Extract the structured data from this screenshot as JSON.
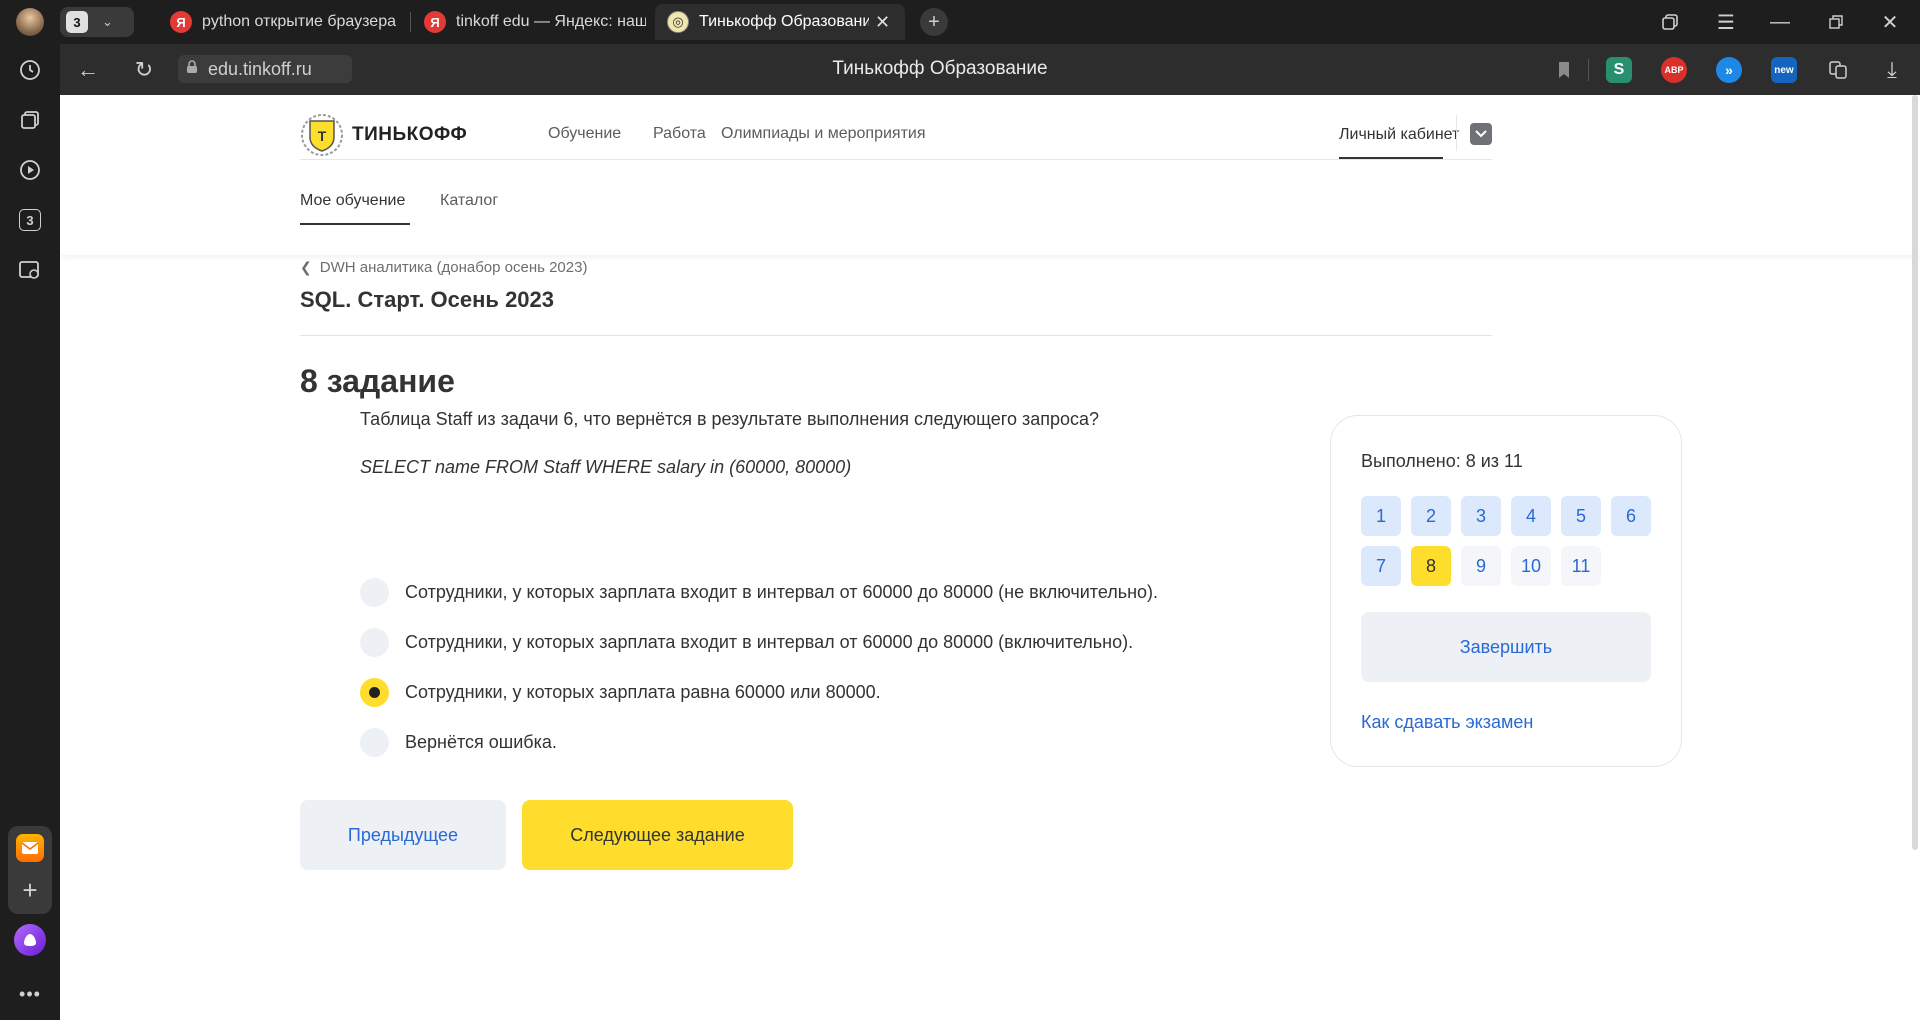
{
  "browser": {
    "tab_count": "3",
    "tabs": [
      {
        "label": "python открытие браузера",
        "favicon": "yandex-icon",
        "active": false
      },
      {
        "label": "tinkoff edu — Яндекс: наш",
        "favicon": "yandex-icon",
        "active": false
      },
      {
        "label": "Тинькофф Образование",
        "favicon": "tinkoff-icon",
        "active": true
      }
    ],
    "url": "edu.tinkoff.ru",
    "page_title": "Тинькофф Образование",
    "extensions": [
      {
        "name": "s-extension-icon",
        "label": "S",
        "color": "#2a8f6e"
      },
      {
        "name": "adblock-icon",
        "label": "ABP",
        "color": "#d9302c"
      },
      {
        "name": "blue-extension-icon",
        "label": "»",
        "color": "#1e88e5"
      },
      {
        "name": "new-extension-icon",
        "label": "new",
        "color": "#1565c0"
      }
    ],
    "sidebar_badge": "3"
  },
  "site": {
    "logo_text": "ТИНЬКОФФ",
    "nav": [
      "Обучение",
      "Работа",
      "Олимпиады и мероприятия"
    ],
    "account": "Личный кабинет",
    "subnav": [
      "Мое обучение",
      "Каталог"
    ]
  },
  "course": {
    "breadcrumb": "DWH аналитика (донабор осень 2023)",
    "title": "SQL. Старт. Осень 2023"
  },
  "task": {
    "heading": "8 задание",
    "question": "Таблица Staff из задачи 6, что вернётся в результате выполнения следующего запроса?",
    "code": "SELECT name FROM Staff WHERE salary in (60000, 80000)",
    "answers": [
      {
        "text": "Сотрудники, у которых зарплата входит в интервал от 60000 до 80000 (не включительно).",
        "selected": false
      },
      {
        "text": "Сотрудники, у которых зарплата входит в интервал от 60000 до 80000 (включительно).",
        "selected": false
      },
      {
        "text": "Сотрудники, у которых зарплата равна 60000 или 80000.",
        "selected": true
      },
      {
        "text": "Вернётся ошибка.",
        "selected": false
      }
    ],
    "prev_label": "Предыдущее",
    "next_label": "Следующее задание"
  },
  "progress": {
    "label": "Выполнено: 8 из 11",
    "completed": 8,
    "total": 11,
    "current": 8,
    "questions": [
      "1",
      "2",
      "3",
      "4",
      "5",
      "6",
      "7",
      "8",
      "9",
      "10",
      "11"
    ],
    "finish_label": "Завершить",
    "help_link": "Как сдавать экзамен"
  },
  "colors": {
    "accent": "#ffdd2d",
    "link": "#2969d6",
    "chrome": "#1e1e1e"
  }
}
